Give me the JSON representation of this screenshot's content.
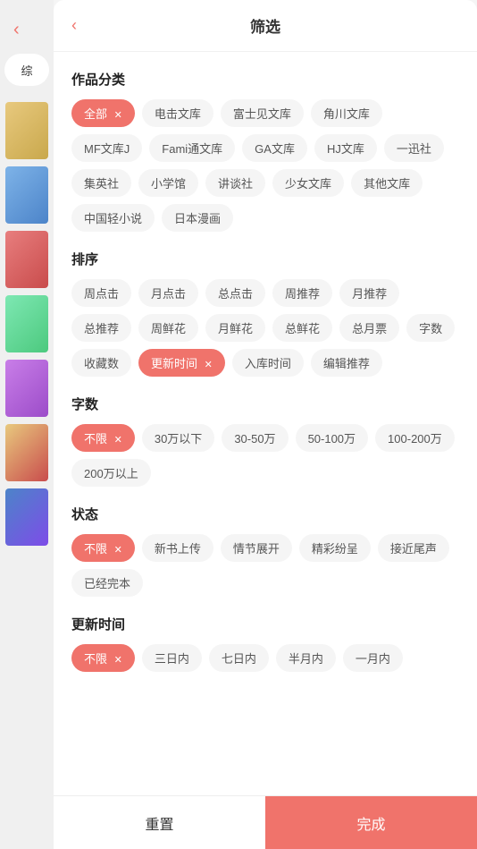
{
  "header": {
    "title": "筛选",
    "back_arrow": "‹"
  },
  "screen_back": "‹",
  "sidebar": {
    "tab_label": "综",
    "books": [
      1,
      2,
      3,
      4,
      5,
      6,
      7
    ]
  },
  "sections": {
    "category": {
      "title": "作品分类",
      "tags": [
        {
          "label": "全部",
          "active": true,
          "closeable": true
        },
        {
          "label": "电击文库",
          "active": false
        },
        {
          "label": "富士见文库",
          "active": false
        },
        {
          "label": "角川文库",
          "active": false
        },
        {
          "label": "MF文库J",
          "active": false
        },
        {
          "label": "Fami通文库",
          "active": false
        },
        {
          "label": "GA文库",
          "active": false
        },
        {
          "label": "HJ文库",
          "active": false
        },
        {
          "label": "一迅社",
          "active": false
        },
        {
          "label": "集英社",
          "active": false
        },
        {
          "label": "小学馆",
          "active": false
        },
        {
          "label": "讲谈社",
          "active": false
        },
        {
          "label": "少女文库",
          "active": false
        },
        {
          "label": "其他文库",
          "active": false
        },
        {
          "label": "中国轻小说",
          "active": false
        },
        {
          "label": "日本漫画",
          "active": false
        }
      ]
    },
    "sort": {
      "title": "排序",
      "tags": [
        {
          "label": "周点击",
          "active": false
        },
        {
          "label": "月点击",
          "active": false
        },
        {
          "label": "总点击",
          "active": false
        },
        {
          "label": "周推荐",
          "active": false
        },
        {
          "label": "月推荐",
          "active": false
        },
        {
          "label": "总推荐",
          "active": false
        },
        {
          "label": "周鲜花",
          "active": false
        },
        {
          "label": "月鲜花",
          "active": false
        },
        {
          "label": "总鲜花",
          "active": false
        },
        {
          "label": "总月票",
          "active": false
        },
        {
          "label": "字数",
          "active": false
        },
        {
          "label": "收藏数",
          "active": false
        },
        {
          "label": "更新时间",
          "active": true,
          "closeable": true
        },
        {
          "label": "入库时间",
          "active": false
        },
        {
          "label": "编辑推荐",
          "active": false
        }
      ]
    },
    "word_count": {
      "title": "字数",
      "tags": [
        {
          "label": "不限",
          "active": true,
          "closeable": true
        },
        {
          "label": "30万以下",
          "active": false
        },
        {
          "label": "30-50万",
          "active": false
        },
        {
          "label": "50-100万",
          "active": false
        },
        {
          "label": "100-200万",
          "active": false
        },
        {
          "label": "200万以上",
          "active": false
        }
      ]
    },
    "status": {
      "title": "状态",
      "tags": [
        {
          "label": "不限",
          "active": true,
          "closeable": true
        },
        {
          "label": "新书上传",
          "active": false
        },
        {
          "label": "情节展开",
          "active": false
        },
        {
          "label": "精彩纷呈",
          "active": false
        },
        {
          "label": "接近尾声",
          "active": false
        },
        {
          "label": "已经完本",
          "active": false
        }
      ]
    },
    "update_time": {
      "title": "更新时间",
      "tags": [
        {
          "label": "不限",
          "active": true,
          "closeable": true
        },
        {
          "label": "三日内",
          "active": false
        },
        {
          "label": "七日内",
          "active": false
        },
        {
          "label": "半月内",
          "active": false
        },
        {
          "label": "一月内",
          "active": false
        }
      ]
    }
  },
  "bottom": {
    "reset_label": "重置",
    "confirm_label": "完成"
  },
  "colors": {
    "accent": "#f0736b",
    "active_tag_bg": "#f0736b",
    "active_tag_text": "#fff"
  }
}
